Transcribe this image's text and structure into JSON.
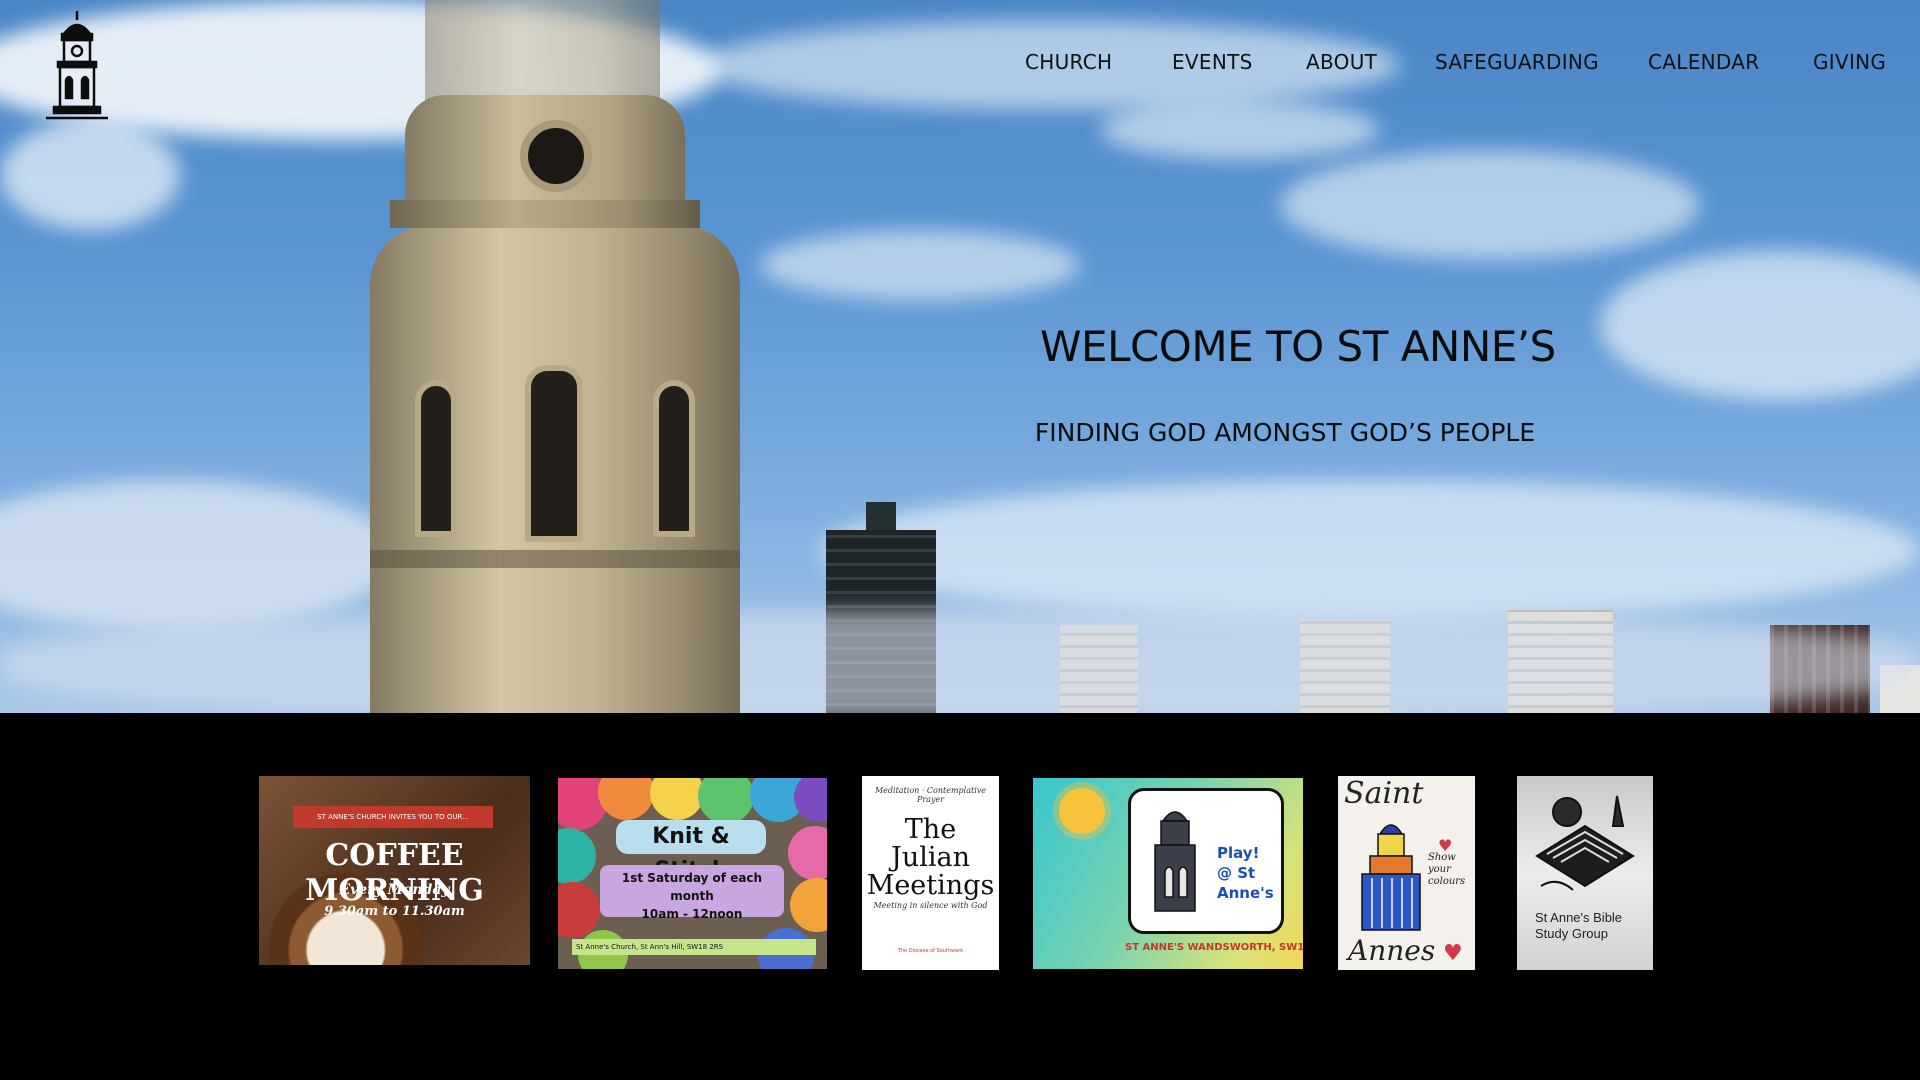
{
  "nav": {
    "items": [
      {
        "label": "CHURCH"
      },
      {
        "label": "EVENTS"
      },
      {
        "label": "ABOUT"
      },
      {
        "label": "SAFEGUARDING"
      },
      {
        "label": "CALENDAR"
      },
      {
        "label": "GIVING"
      }
    ]
  },
  "hero": {
    "title": "WELCOME TO ST ANNE’S",
    "subtitle": "FINDING GOD AMONGST GOD’S PEOPLE"
  },
  "cards": {
    "coffee": {
      "banner": "ST ANNE'S CHURCH INVITES YOU TO OUR...",
      "title": "COFFEE MORNING",
      "line1": "Every Monday",
      "line2": "9.30am to 11.30am"
    },
    "knit": {
      "title": "Knit & Stitch",
      "line1": "1st Saturday of each month",
      "line2": "10am - 12noon",
      "footer": "St Anne's Church, St Ann's Hill, SW18 2RS"
    },
    "julian": {
      "top": "Meditation · Contemplative Prayer",
      "title": "The Julian Meetings",
      "bottom": "Meeting in silence with God",
      "footer": "The Diocese of Southwark"
    },
    "play": {
      "title": "Play!",
      "subtitle": "@ St Anne's",
      "footer": "ST ANNE'S WANDSWORTH, SW18 2RS"
    },
    "saint": {
      "top": "Saint",
      "bottom": "Annes",
      "side": "Show your colours"
    },
    "bible": {
      "label": "St Anne's Bible Study Group"
    }
  },
  "colors": {
    "page_bg": "#000000",
    "nav_text": "#111111",
    "sky": "#5a95d2"
  },
  "icons": {
    "logo": "church-tower-icon"
  }
}
